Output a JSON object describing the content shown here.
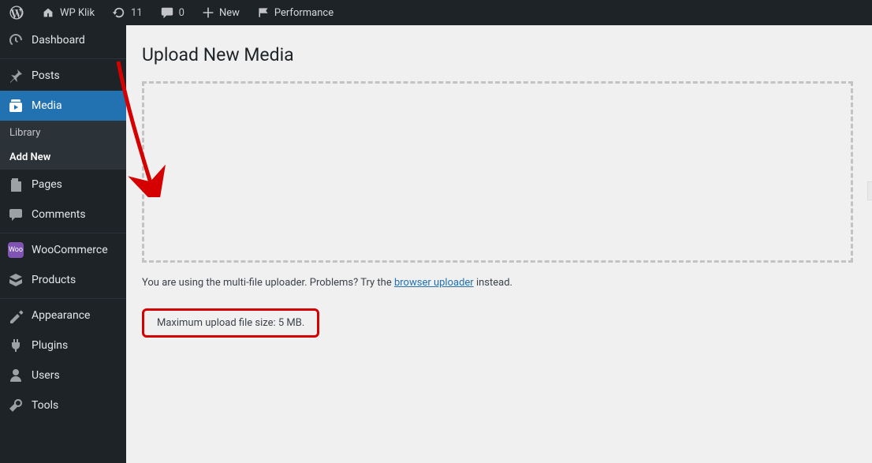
{
  "adminbar": {
    "site_name": "WP Klik",
    "updates_count": "11",
    "comments_count": "0",
    "new_label": "New",
    "performance_label": "Performance"
  },
  "sidemenu": {
    "dashboard": "Dashboard",
    "posts": "Posts",
    "media": "Media",
    "media_sub": {
      "library": "Library",
      "addnew": "Add New"
    },
    "pages": "Pages",
    "comments": "Comments",
    "woocommerce": "WooCommerce",
    "products": "Products",
    "appearance": "Appearance",
    "plugins": "Plugins",
    "users": "Users",
    "tools": "Tools"
  },
  "main": {
    "title": "Upload New Media",
    "hint_prefix": "You are using the multi-file uploader. Problems? Try the ",
    "hint_link": "browser uploader",
    "hint_suffix": " instead.",
    "max_note": "Maximum upload file size: 5 MB."
  }
}
